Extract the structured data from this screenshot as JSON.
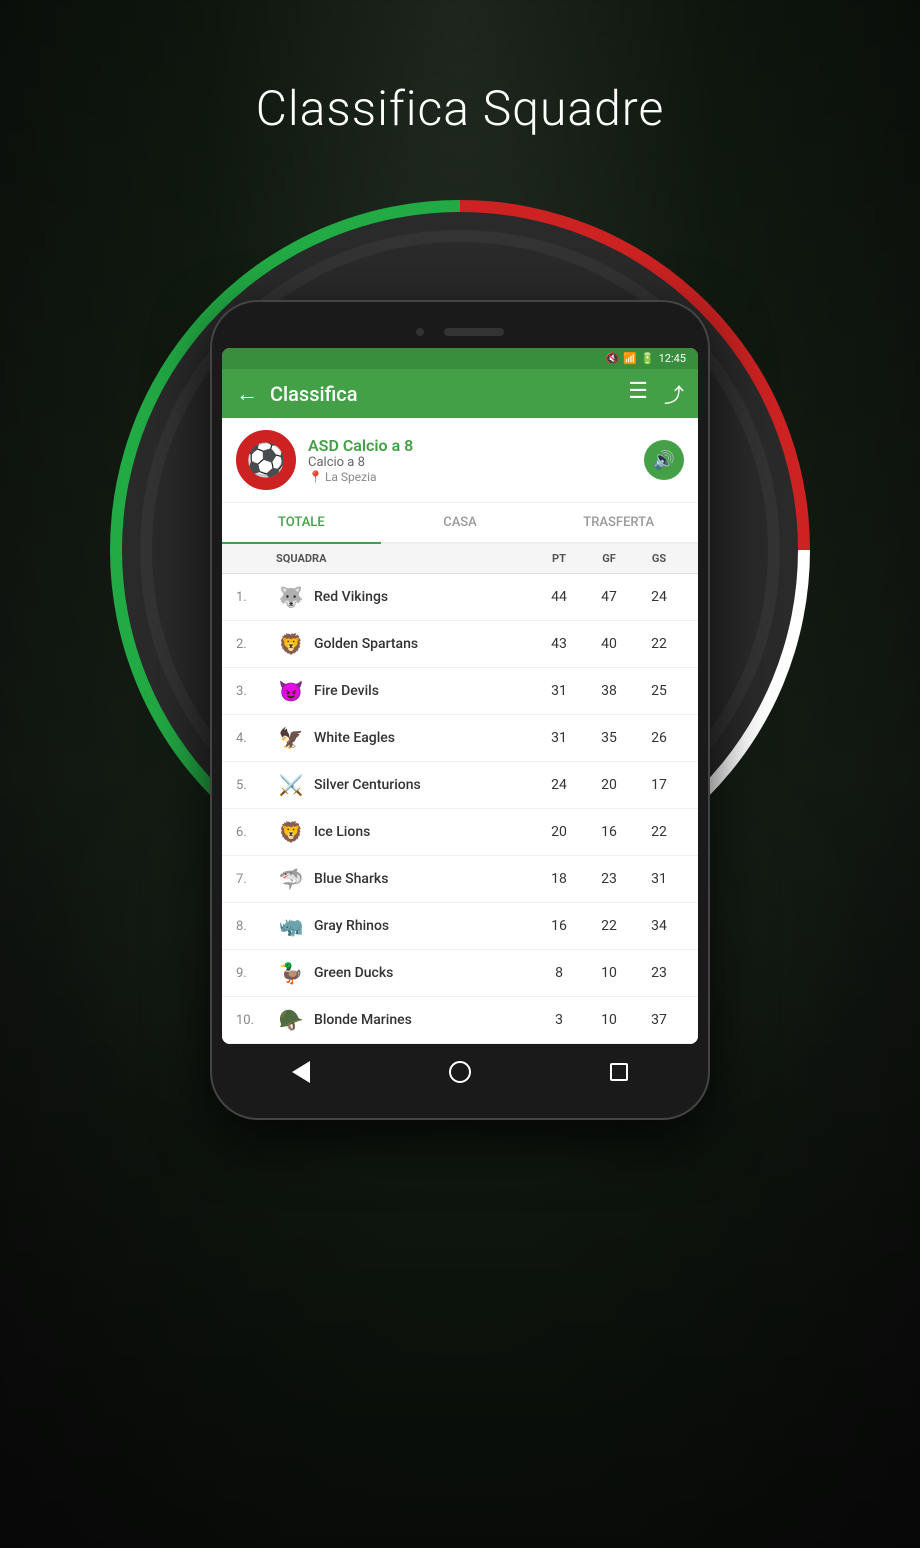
{
  "page": {
    "title": "Classifica Squadre",
    "background": "#2a2a2a"
  },
  "statusBar": {
    "time": "12:45",
    "icons": [
      "mute",
      "signal",
      "battery"
    ]
  },
  "appBar": {
    "backLabel": "←",
    "title": "Classifica",
    "listIconLabel": "☰",
    "shareIconLabel": "⤴"
  },
  "clubInfo": {
    "name": "ASD Calcio a 8",
    "type": "Calcio a 8",
    "location": "La Spezia",
    "logoEmoji": "⚽"
  },
  "tabs": [
    {
      "id": "totale",
      "label": "TOTALE",
      "active": true
    },
    {
      "id": "casa",
      "label": "CASA",
      "active": false
    },
    {
      "id": "trasferta",
      "label": "TRASFERTA",
      "active": false
    }
  ],
  "tableHeader": {
    "team": "SQUADRA",
    "pt": "pt",
    "gf": "gf",
    "gs": "gs"
  },
  "teams": [
    {
      "rank": "1.",
      "name": "Red Vikings",
      "emoji": "🐺",
      "pt": 44,
      "gf": 47,
      "gs": 24
    },
    {
      "rank": "2.",
      "name": "Golden Spartans",
      "emoji": "🦁",
      "pt": 43,
      "gf": 40,
      "gs": 22
    },
    {
      "rank": "3.",
      "name": "Fire Devils",
      "emoji": "😈",
      "pt": 31,
      "gf": 38,
      "gs": 25
    },
    {
      "rank": "4.",
      "name": "White Eagles",
      "emoji": "🦅",
      "pt": 31,
      "gf": 35,
      "gs": 26
    },
    {
      "rank": "5.",
      "name": "Silver Centurions",
      "emoji": "⚔️",
      "pt": 24,
      "gf": 20,
      "gs": 17
    },
    {
      "rank": "6.",
      "name": "Ice Lions",
      "emoji": "🦁",
      "pt": 20,
      "gf": 16,
      "gs": 22
    },
    {
      "rank": "7.",
      "name": "Blue Sharks",
      "emoji": "🦈",
      "pt": 18,
      "gf": 23,
      "gs": 31
    },
    {
      "rank": "8.",
      "name": "Gray Rhinos",
      "emoji": "🦏",
      "pt": 16,
      "gf": 22,
      "gs": 34
    },
    {
      "rank": "9.",
      "name": "Green Ducks",
      "emoji": "🦆",
      "pt": 8,
      "gf": 10,
      "gs": 23
    },
    {
      "rank": "10.",
      "name": "Blonde Marines",
      "emoji": "🪖",
      "pt": 3,
      "gf": 10,
      "gs": 37
    }
  ],
  "bottomNav": {
    "backLabel": "◀",
    "homeLabel": "○",
    "recentLabel": "□"
  }
}
